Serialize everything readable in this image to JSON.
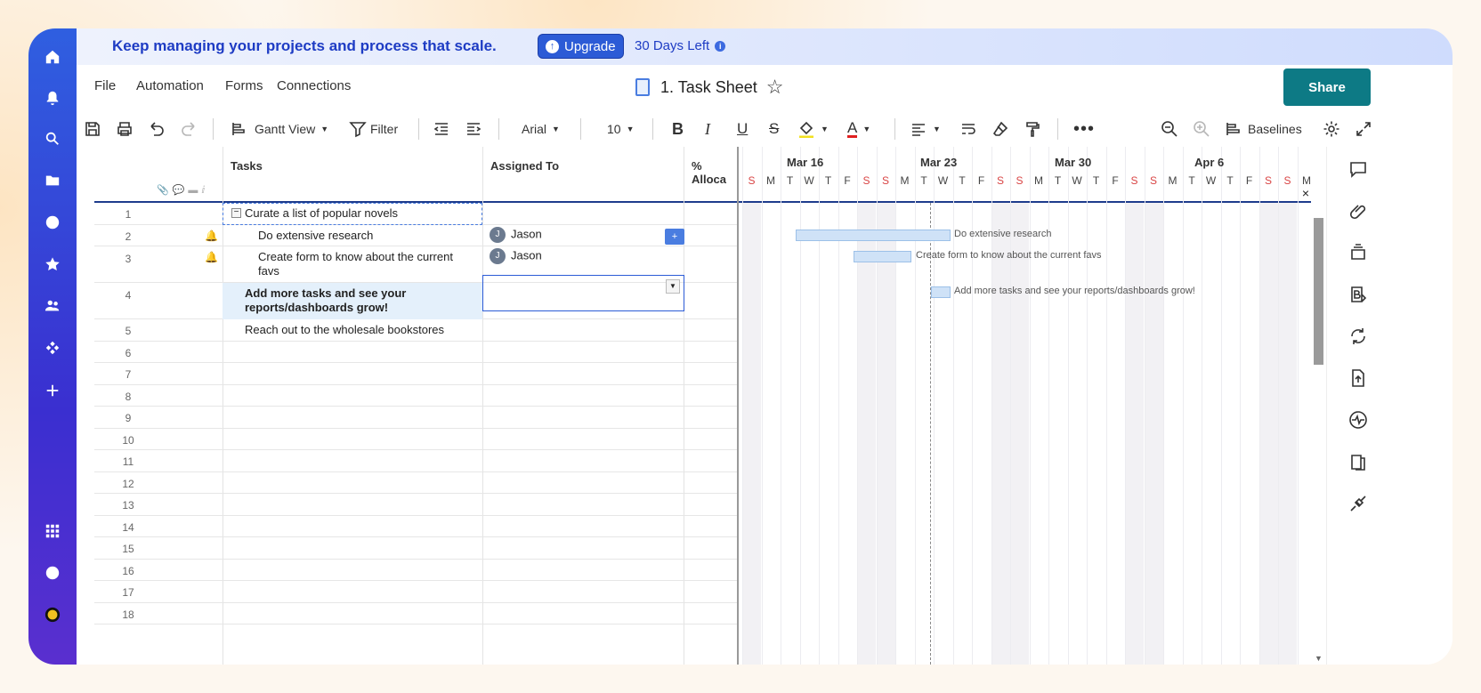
{
  "banner": {
    "message": "Keep managing your projects and process that scale.",
    "upgrade": "Upgrade",
    "days_left": "30 Days Left"
  },
  "menu": {
    "file": "File",
    "automation": "Automation",
    "forms": "Forms",
    "connections": "Connections"
  },
  "document": {
    "title": "1. Task Sheet"
  },
  "share": "Share",
  "toolbar": {
    "view": "Gantt View",
    "filter": "Filter",
    "font": "Arial",
    "size": "10",
    "baselines": "Baselines"
  },
  "columns": {
    "tasks": "Tasks",
    "assigned": "Assigned To",
    "alloc": "% Alloca"
  },
  "rows": [
    {
      "n": "1",
      "task": "Curate a list of popular novels",
      "assigned": ""
    },
    {
      "n": "2",
      "task": "Do extensive research",
      "assigned": "Jason"
    },
    {
      "n": "3",
      "task": "Create form to know about the current favs",
      "assigned": "Jason"
    },
    {
      "n": "4",
      "task": "Add more tasks and see your reports/dashboards grow!",
      "assigned": ""
    },
    {
      "n": "5",
      "task": "Reach out to the wholesale bookstores",
      "assigned": ""
    },
    {
      "n": "6"
    },
    {
      "n": "7"
    },
    {
      "n": "8"
    },
    {
      "n": "9"
    },
    {
      "n": "10"
    },
    {
      "n": "11"
    },
    {
      "n": "12"
    },
    {
      "n": "13"
    },
    {
      "n": "14"
    },
    {
      "n": "15"
    },
    {
      "n": "16"
    },
    {
      "n": "17"
    },
    {
      "n": "18"
    }
  ],
  "gantt": {
    "weeks": [
      "Mar 16",
      "Mar 23",
      "Mar 30",
      "Apr 6"
    ],
    "days": [
      "S",
      "M",
      "T",
      "W",
      "T",
      "F",
      "S",
      "S",
      "M",
      "T",
      "W",
      "T",
      "F",
      "S",
      "S",
      "M",
      "T",
      "W",
      "T",
      "F",
      "S",
      "S",
      "M",
      "T",
      "W",
      "T",
      "F",
      "S",
      "S",
      "M"
    ],
    "bars": [
      {
        "label": "Do extensive research"
      },
      {
        "label": "Create form to know about the current favs"
      },
      {
        "label": "Add more tasks and see your reports/dashboards grow!"
      }
    ]
  },
  "avatar_initial": "J",
  "close": "×"
}
